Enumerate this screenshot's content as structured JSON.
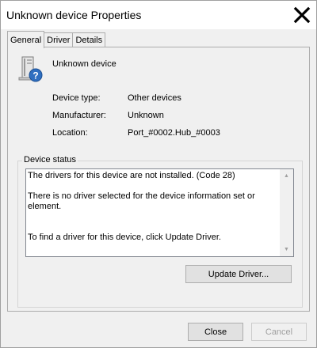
{
  "window": {
    "title": "Unknown device Properties",
    "close_icon": "close-icon"
  },
  "tabs": [
    {
      "label": "General",
      "active": true
    },
    {
      "label": "Driver",
      "active": false
    },
    {
      "label": "Details",
      "active": false
    }
  ],
  "general": {
    "device_icon": "unknown-device-icon",
    "device_name": "Unknown device",
    "properties": [
      {
        "label": "Device type:",
        "value": "Other devices"
      },
      {
        "label": "Manufacturer:",
        "value": "Unknown"
      },
      {
        "label": "Location:",
        "value": "Port_#0002.Hub_#0003"
      }
    ],
    "device_status": {
      "title": "Device status",
      "lines": [
        "The drivers for this device are not installed. (Code 28)",
        "There is no driver selected for the device information set or element.",
        "To find a driver for this device, click Update Driver."
      ],
      "update_driver_label": "Update Driver..."
    }
  },
  "footer": {
    "close_label": "Close",
    "cancel_label": "Cancel",
    "cancel_enabled": false
  }
}
